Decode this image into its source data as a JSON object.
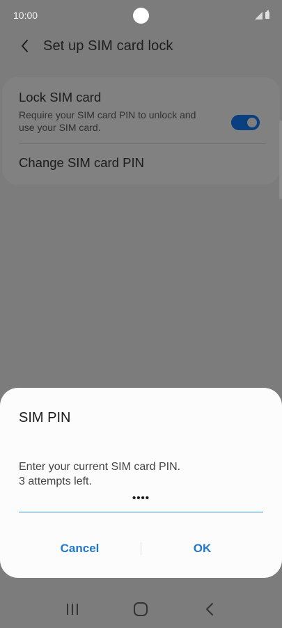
{
  "status_bar": {
    "time": "10:00",
    "icons": [
      "signal-icon",
      "battery-icon"
    ]
  },
  "header": {
    "back_icon": "chevron-left-icon",
    "title": "Set up SIM card lock"
  },
  "settings": {
    "lock_sim": {
      "title": "Lock SIM card",
      "subtitle": "Require your SIM card PIN to unlock and use your SIM card.",
      "toggle_on": true
    },
    "change_pin": {
      "title": "Change SIM card PIN"
    }
  },
  "dialog": {
    "title": "SIM PIN",
    "message_line1": "Enter your current SIM card PIN.",
    "message_line2": "3 attempts left.",
    "pin_value": "••••",
    "cancel_label": "Cancel",
    "ok_label": "OK"
  },
  "nav_bar": {
    "items": [
      "recent-apps-icon",
      "home-icon",
      "back-icon"
    ]
  },
  "colors": {
    "accent": "#2177c9",
    "toggle": "#0a3f80",
    "input_underline": "#2f93de",
    "scrim": "#7c7c7c"
  }
}
